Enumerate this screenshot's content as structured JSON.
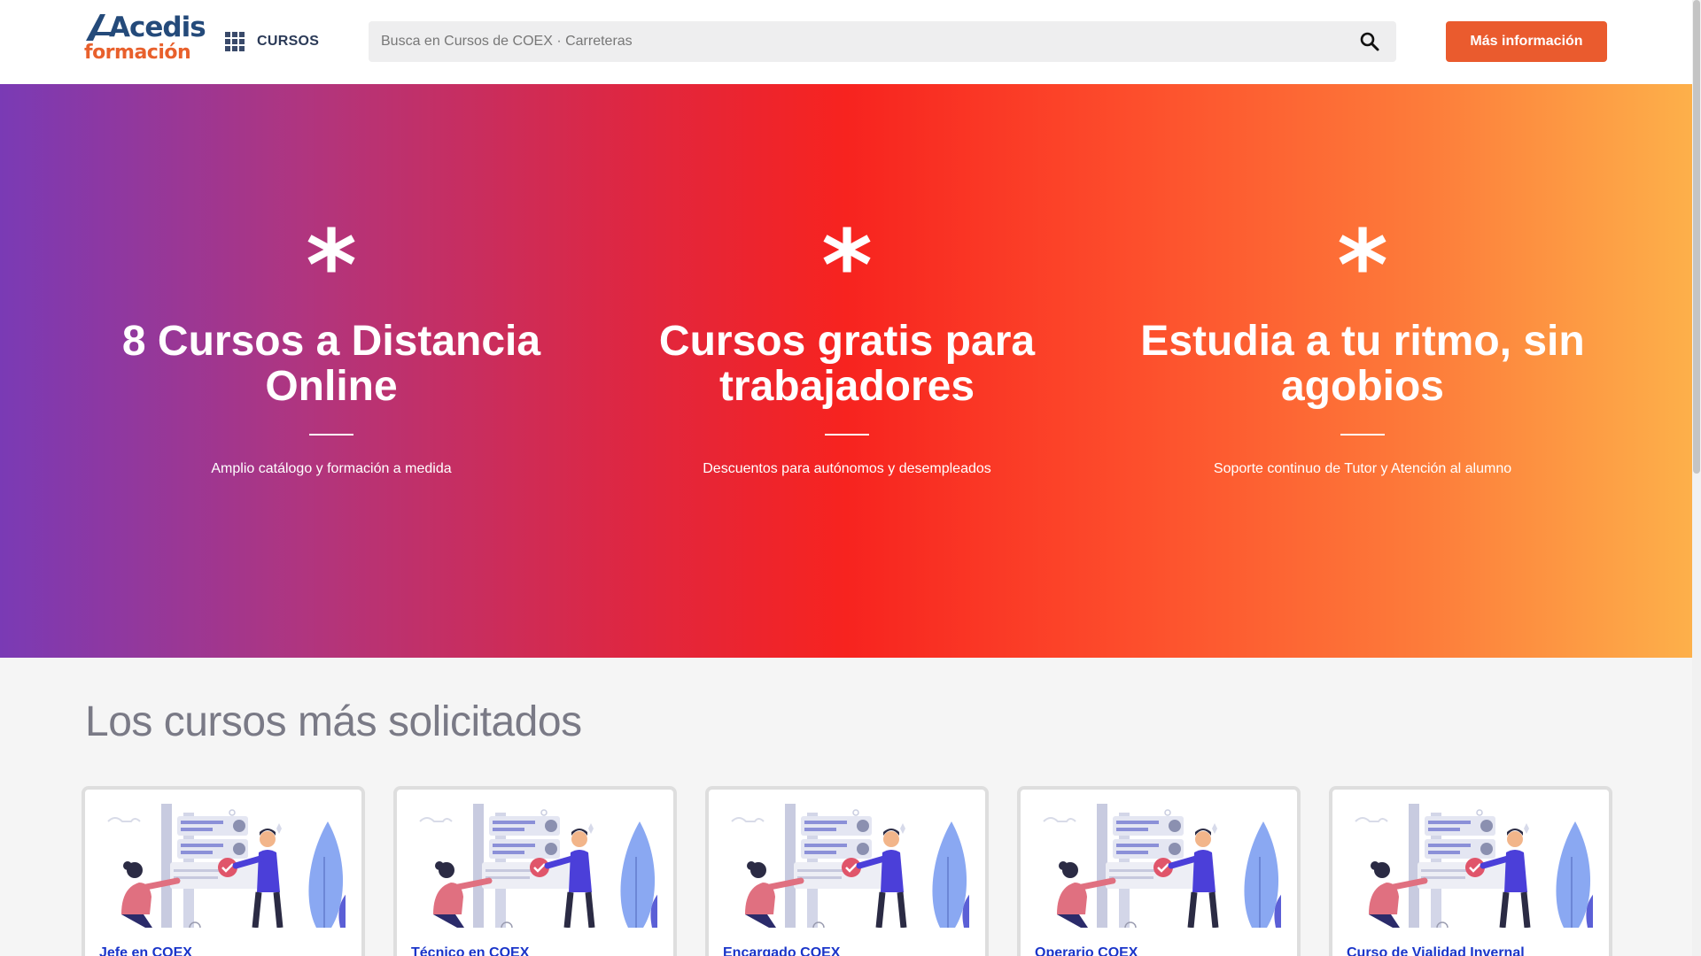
{
  "header": {
    "logo_top": "Acedis",
    "logo_bottom": "formación",
    "menu_label": "CURSOS",
    "search_placeholder": "Busca en Cursos de COEX · Carreteras",
    "info_button": "Más información"
  },
  "hero": {
    "columns": [
      {
        "star": "*",
        "title": "8 Cursos a Distancia Online",
        "subtitle": "Amplio catálogo y formación a medida"
      },
      {
        "star": "*",
        "title": "Cursos gratis para trabajadores",
        "subtitle": "Descuentos para autónomos y desempleados"
      },
      {
        "star": "*",
        "title": "Estudia a tu ritmo, sin agobios",
        "subtitle": "Soporte continuo de Tutor y Atención al alumno"
      }
    ]
  },
  "section": {
    "title": "Los cursos más solicitados",
    "cards": [
      {
        "title": "Jefe en COEX"
      },
      {
        "title": "Técnico en COEX"
      },
      {
        "title": "Encargado COEX"
      },
      {
        "title": "Operario COEX"
      },
      {
        "title": "Curso de Vialidad Invernal"
      }
    ]
  },
  "colors": {
    "accent": "#ea5b2e",
    "logo_blue": "#244a7a",
    "card_title": "#1a35c9"
  }
}
